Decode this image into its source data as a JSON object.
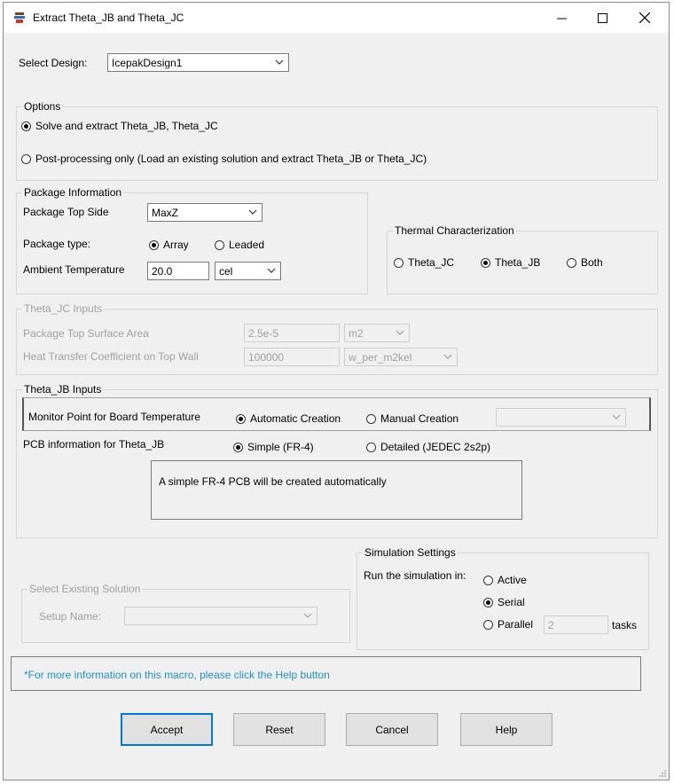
{
  "window": {
    "title": "Extract Theta_JB and Theta_JC",
    "minimize_icon": "minimize-icon",
    "maximize_icon": "maximize-icon",
    "close_icon": "close-icon"
  },
  "design": {
    "label": "Select Design:",
    "value": "IcepakDesign1"
  },
  "options": {
    "title": "Options",
    "solve_label": "Solve and extract Theta_JB, Theta_JC",
    "post_label": "Post-processing only (Load an existing solution and extract Theta_JB or Theta_JC)",
    "selected": "solve"
  },
  "package": {
    "title": "Package Information",
    "top_side_label": "Package Top Side",
    "top_side_value": "MaxZ",
    "type_label": "Package type:",
    "type_array": "Array",
    "type_leaded": "Leaded",
    "type_selected": "array",
    "ambient_label": "Ambient Temperature",
    "ambient_value": "20.0",
    "ambient_unit": "cel"
  },
  "thermal": {
    "title": "Thermal Characterization",
    "opt_jc": "Theta_JC",
    "opt_jb": "Theta_JB",
    "opt_both": "Both",
    "selected": "jb"
  },
  "jc_inputs": {
    "title": "Theta_JC Inputs",
    "area_label": "Package Top Surface Area",
    "area_value": "2.5e-5",
    "area_unit": "m2",
    "htc_label": "Heat Transfer Coefficient on Top Wall",
    "htc_value": "100000",
    "htc_unit": "w_per_m2kel"
  },
  "jb_inputs": {
    "title": "Theta_JB Inputs",
    "monitor_label": "Monitor Point for Board Temperature",
    "auto_label": "Automatic Creation",
    "manual_label": "Manual Creation",
    "monitor_selected": "auto",
    "manual_value": "",
    "pcb_label": "PCB information for Theta_JB",
    "simple_label": "Simple (FR-4)",
    "detailed_label": "Detailed (JEDEC 2s2p)",
    "pcb_selected": "simple",
    "pcb_note": "A simple FR-4 PCB will be created automatically"
  },
  "existing": {
    "title": "Select Existing Solution",
    "setup_label": "Setup Name:",
    "setup_value": ""
  },
  "simulation": {
    "title": "Simulation Settings",
    "run_label": "Run the simulation in:",
    "active_label": "Active",
    "serial_label": "Serial",
    "parallel_label": "Parallel",
    "selected": "serial",
    "tasks_value": "2",
    "tasks_label": "tasks"
  },
  "info_text": "*For more information on this macro, please click the Help button",
  "buttons": {
    "accept": "Accept",
    "reset": "Reset",
    "cancel": "Cancel",
    "help": "Help"
  },
  "colors": {
    "accent": "#0078d7",
    "info_text": "#1e8fc6",
    "disabled_text": "#a0a0a0"
  }
}
